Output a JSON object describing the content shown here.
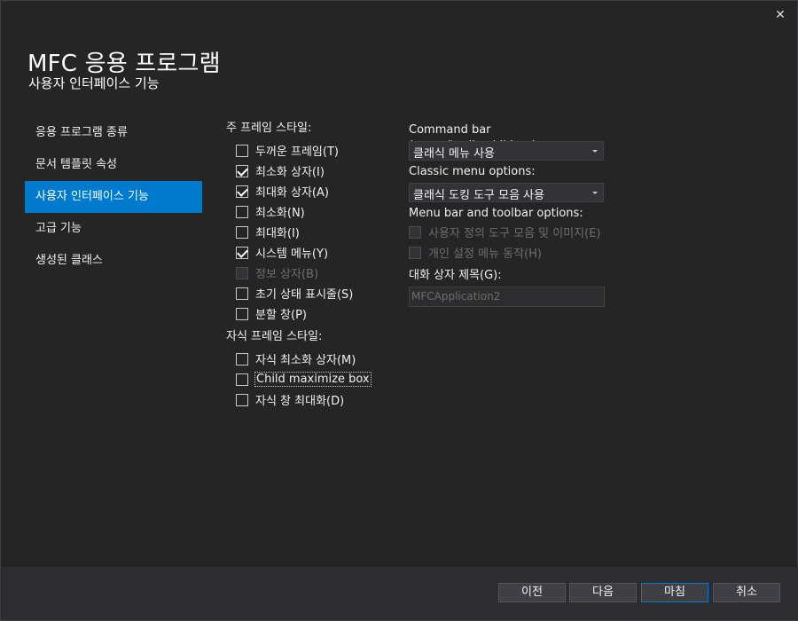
{
  "window": {
    "close_glyph": "✕"
  },
  "header": {
    "title": "MFC 응용 프로그램",
    "subtitle": "사용자 인터페이스 기능"
  },
  "nav": {
    "items": [
      {
        "label": "응용 프로그램 종류",
        "active": false
      },
      {
        "label": "문서 템플릿 속성",
        "active": false
      },
      {
        "label": "사용자 인터페이스 기능",
        "active": true
      },
      {
        "label": "고급 기능",
        "active": false
      },
      {
        "label": "생성된 클래스",
        "active": false
      }
    ]
  },
  "main_frame": {
    "label": "주 프레임 스타일:",
    "options": [
      {
        "label": "두꺼운 프레임(T)",
        "checked": false,
        "enabled": true
      },
      {
        "label": "최소화 상자(I)",
        "checked": true,
        "enabled": true
      },
      {
        "label": "최대화 상자(A)",
        "checked": true,
        "enabled": true
      },
      {
        "label": "최소화(N)",
        "checked": false,
        "enabled": true
      },
      {
        "label": "최대화(I)",
        "checked": false,
        "enabled": true
      },
      {
        "label": "시스템 메뉴(Y)",
        "checked": true,
        "enabled": true
      },
      {
        "label": "정보 상자(B)",
        "checked": false,
        "enabled": false
      },
      {
        "label": "초기 상태 표시줄(S)",
        "checked": false,
        "enabled": true
      },
      {
        "label": "분할 창(P)",
        "checked": false,
        "enabled": true
      }
    ]
  },
  "child_frame": {
    "label": "자식 프레임 스타일:",
    "options": [
      {
        "label": "자식 최소화 상자(M)",
        "checked": false,
        "enabled": true
      },
      {
        "label": "Child maximize box",
        "checked": false,
        "enabled": true,
        "focused": true
      },
      {
        "label": "자식 창 최대화(D)",
        "checked": false,
        "enabled": true
      }
    ]
  },
  "command_bar": {
    "label": "Command bar (menu/toolbar/ribbon):",
    "value": "클래식 메뉴 사용"
  },
  "classic_menu": {
    "label": "Classic menu options:",
    "value": "클래식 도킹 도구 모음 사용"
  },
  "menubar_toolbar": {
    "label": "Menu bar and toolbar options:",
    "options": [
      {
        "label": "사용자 정의 도구 모음 및 이미지(E)",
        "checked": false,
        "enabled": false
      },
      {
        "label": "개인 설정 메뉴 동작(H)",
        "checked": false,
        "enabled": false
      }
    ]
  },
  "dialog_title": {
    "label": "대화 상자 제목(G):",
    "value": "MFCApplication2"
  },
  "footer": {
    "prev": "이전",
    "next": "다음",
    "finish": "마침",
    "cancel": "취소"
  },
  "colors": {
    "accent": "#007acc",
    "background": "#252526",
    "footer_bg": "#2d2d30"
  }
}
